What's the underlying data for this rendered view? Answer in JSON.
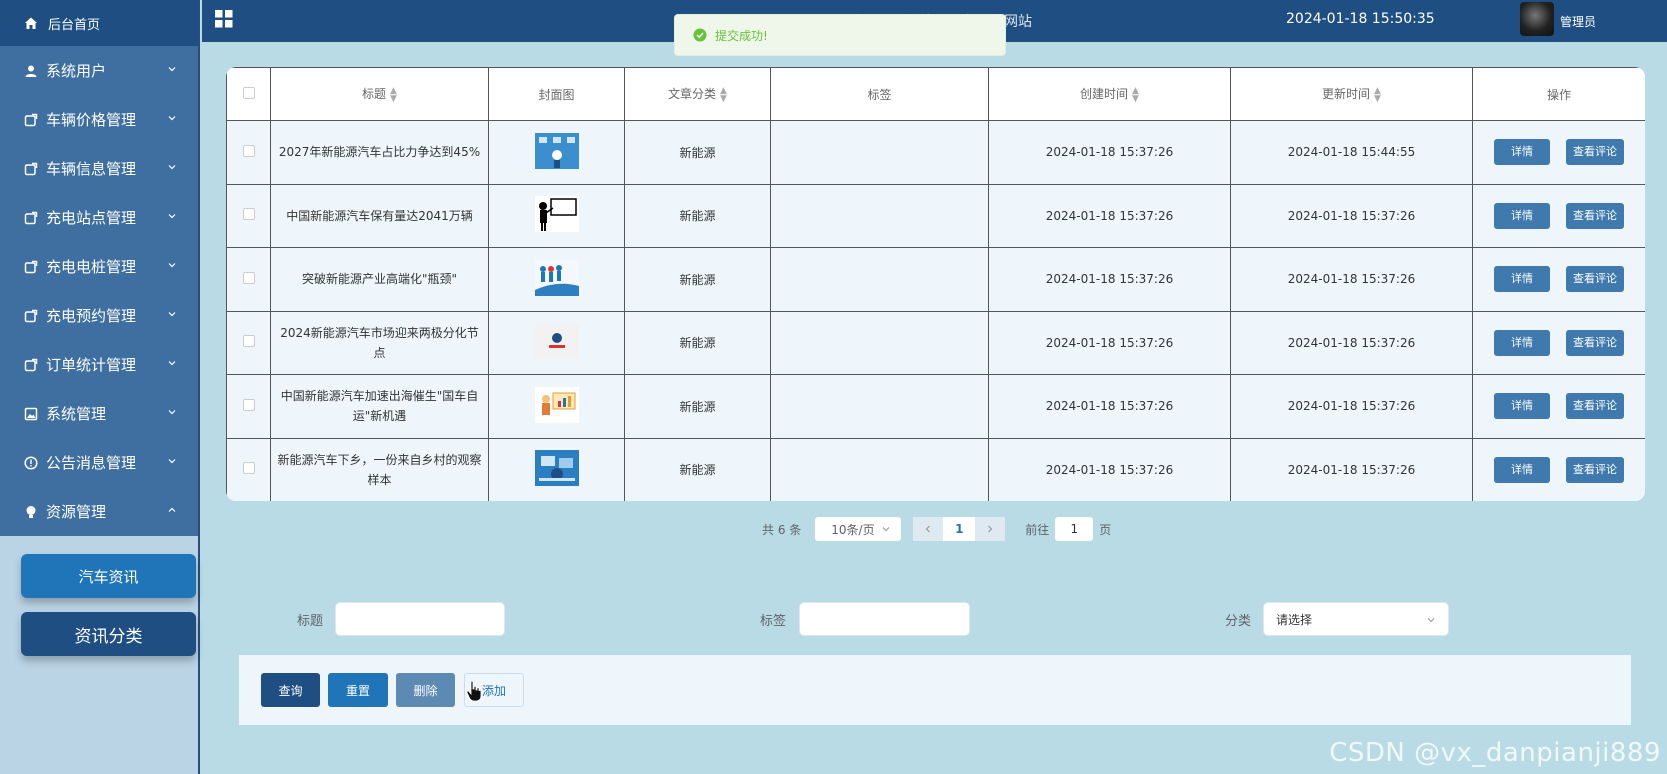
{
  "sidebar": {
    "home": "后台首页",
    "items": [
      {
        "label": "系统用户",
        "icon": "user-icon"
      },
      {
        "label": "车辆价格管理",
        "icon": "external-link-icon"
      },
      {
        "label": "车辆信息管理",
        "icon": "external-link-icon"
      },
      {
        "label": "充电站点管理",
        "icon": "external-link-icon"
      },
      {
        "label": "充电电桩管理",
        "icon": "external-link-icon"
      },
      {
        "label": "充电预约管理",
        "icon": "external-link-icon"
      },
      {
        "label": "订单统计管理",
        "icon": "external-link-icon"
      },
      {
        "label": "系统管理",
        "icon": "image-icon"
      },
      {
        "label": "公告消息管理",
        "icon": "info-icon"
      },
      {
        "label": "资源管理",
        "icon": "bulb-icon"
      }
    ],
    "sub_items": [
      "汽车资讯",
      "资讯分类"
    ]
  },
  "topbar": {
    "title": "欢迎使用新能源汽车服务网站",
    "clock": "2024-01-18 15:50:35",
    "user": "管理员"
  },
  "toast": "提交成功!",
  "table": {
    "headers": [
      "标题",
      "封面图",
      "文章分类",
      "标签",
      "创建时间",
      "更新时间",
      "操作"
    ],
    "rows": [
      {
        "title": "2027年新能源汽车占比力争达到45%",
        "category": "新能源",
        "tag": "",
        "created": "2024-01-18 15:37:26",
        "updated": "2024-01-18 15:44:55"
      },
      {
        "title": "中国新能源汽车保有量达2041万辆",
        "category": "新能源",
        "tag": "",
        "created": "2024-01-18 15:37:26",
        "updated": "2024-01-18 15:37:26"
      },
      {
        "title": "突破新能源产业高端化\"瓶颈\"",
        "category": "新能源",
        "tag": "",
        "created": "2024-01-18 15:37:26",
        "updated": "2024-01-18 15:37:26"
      },
      {
        "title": "2024新能源汽车市场迎来两极分化节点",
        "category": "新能源",
        "tag": "",
        "created": "2024-01-18 15:37:26",
        "updated": "2024-01-18 15:37:26"
      },
      {
        "title": "中国新能源汽车加速出海催生\"国车自运\"新机遇",
        "category": "新能源",
        "tag": "",
        "created": "2024-01-18 15:37:26",
        "updated": "2024-01-18 15:37:26"
      },
      {
        "title": "新能源汽车下乡，一份来自乡村的观察样本",
        "category": "新能源",
        "tag": "",
        "created": "2024-01-18 15:37:26",
        "updated": "2024-01-18 15:37:26"
      }
    ],
    "detail_label": "详情",
    "comment_label": "查看评论"
  },
  "pager": {
    "total": "共 6 条",
    "size": "10条/页",
    "current": "1",
    "goto_prefix": "前往",
    "goto_value": "1",
    "goto_suffix": "页"
  },
  "search": {
    "title_label": "标题",
    "tag_label": "标签",
    "category_label": "分类",
    "category_value": "请选择"
  },
  "actions": {
    "query": "查询",
    "reset": "重置",
    "delete": "删除",
    "add": "添加"
  },
  "watermark": "CSDN @vx_danpianji889"
}
